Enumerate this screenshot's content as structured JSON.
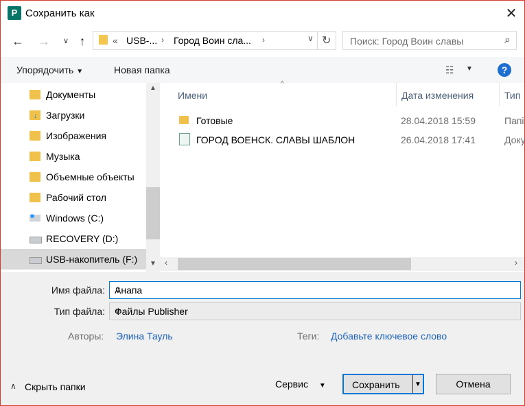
{
  "window": {
    "title": "Сохранить как",
    "app_icon_letter": "P",
    "accent": "#077568"
  },
  "nav": {
    "breadcrumb_overflow": "«",
    "breadcrumb": [
      "USB-...",
      "Город Воин сла..."
    ],
    "search_placeholder": "Поиск: Город Воин славы"
  },
  "toolbar": {
    "organize": "Упорядочить",
    "new_folder": "Новая папка"
  },
  "tree": {
    "items": [
      {
        "label": "Документы",
        "icon": "documents-icon"
      },
      {
        "label": "Загрузки",
        "icon": "downloads-icon"
      },
      {
        "label": "Изображения",
        "icon": "pictures-icon"
      },
      {
        "label": "Музыка",
        "icon": "music-icon"
      },
      {
        "label": "Объемные объекты",
        "icon": "3d-objects-icon"
      },
      {
        "label": "Рабочий стол",
        "icon": "desktop-icon"
      },
      {
        "label": "Windows (C:)",
        "icon": "windows-drive-icon"
      },
      {
        "label": "RECOVERY (D:)",
        "icon": "drive-icon"
      },
      {
        "label": "USB-накопитель (F:)",
        "icon": "usb-drive-icon",
        "selected": true
      }
    ]
  },
  "files": {
    "columns": [
      "Имени",
      "Дата изменения",
      "Тип"
    ],
    "rows": [
      {
        "name": "Готовые",
        "date": "28.04.2018 15:59",
        "type": "Папі",
        "icon": "folder-icon"
      },
      {
        "name": "ГОРОД ВОЕНСК. СЛАВЫ ШАБЛОН",
        "date": "26.04.2018 17:41",
        "type": "Доку",
        "icon": "publisher-file-icon"
      }
    ]
  },
  "form": {
    "filename_label": "Имя файла:",
    "filename_value": "Анапа",
    "filetype_label": "Тип файла:",
    "filetype_value": "Файлы Publisher",
    "authors_label": "Авторы:",
    "authors_value": "Элина Тауль",
    "tags_label": "Теги:",
    "tags_value": "Добавьте ключевое слово"
  },
  "footer": {
    "hide_folders": "Скрыть папки",
    "service": "Сервис",
    "save": "Сохранить",
    "cancel": "Отмена"
  }
}
